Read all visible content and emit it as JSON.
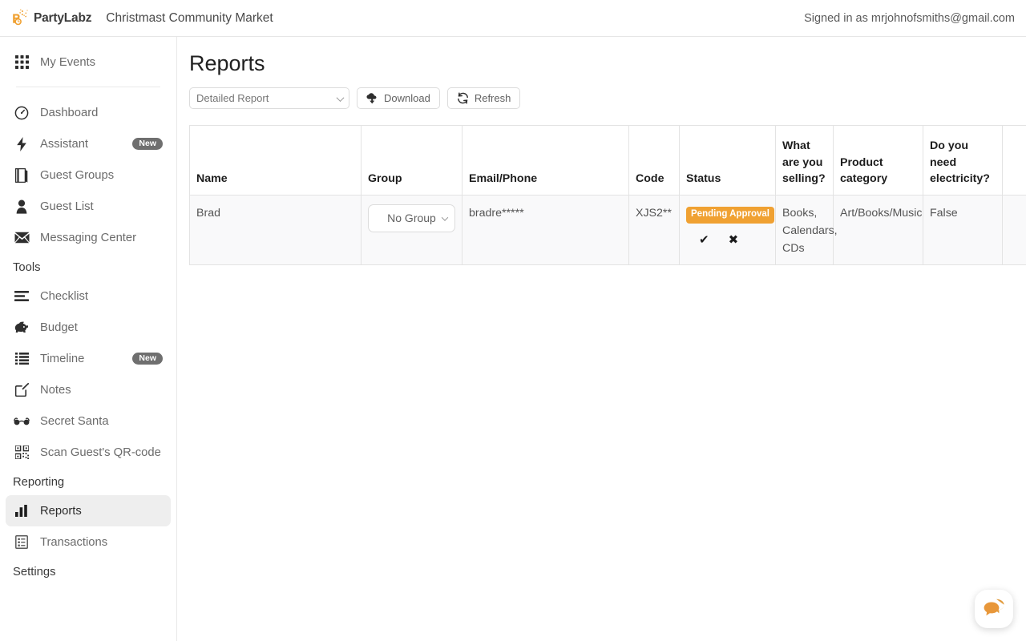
{
  "header": {
    "brand_name": "PartyLabz",
    "event_title": "Christmast Community Market",
    "signed_in": "Signed in as mrjohnofsmiths@gmail.com",
    "logo_icon": "partylabz-logo-icon"
  },
  "sidebar": {
    "top": [
      {
        "label": "My Events",
        "icon": "grid-icon"
      }
    ],
    "primary": [
      {
        "label": "Dashboard",
        "icon": "speedometer-icon",
        "badge": ""
      },
      {
        "label": "Assistant",
        "icon": "lightning-bolt-icon",
        "badge": "New"
      },
      {
        "label": "Guest Groups",
        "icon": "book-icon",
        "badge": ""
      },
      {
        "label": "Guest List",
        "icon": "person-icon",
        "badge": ""
      },
      {
        "label": "Messaging Center",
        "icon": "envelope-icon",
        "badge": ""
      }
    ],
    "tools_title": "Tools",
    "tools": [
      {
        "label": "Checklist",
        "icon": "checklist-icon",
        "badge": ""
      },
      {
        "label": "Budget",
        "icon": "piggy-bank-icon",
        "badge": ""
      },
      {
        "label": "Timeline",
        "icon": "list-icon",
        "badge": "New"
      },
      {
        "label": "Notes",
        "icon": "note-edit-icon",
        "badge": ""
      },
      {
        "label": "Secret Santa",
        "icon": "glasses-icon",
        "badge": ""
      },
      {
        "label": "Scan Guest's QR-code",
        "icon": "qr-code-icon",
        "badge": ""
      }
    ],
    "reporting_title": "Reporting",
    "reporting": [
      {
        "label": "Reports",
        "icon": "bar-chart-icon",
        "badge": "",
        "active": true
      },
      {
        "label": "Transactions",
        "icon": "receipt-icon",
        "badge": "",
        "active": false
      }
    ],
    "settings_title": "Settings"
  },
  "main": {
    "page_title": "Reports",
    "report_select": {
      "value": "Detailed Report",
      "options": [
        "Detailed Report"
      ]
    },
    "download_label": "Download",
    "refresh_label": "Refresh",
    "download_icon": "cloud-download-icon",
    "refresh_icon": "refresh-icon"
  },
  "table": {
    "columns": [
      "Name",
      "Group",
      "Email/Phone",
      "Code",
      "Status",
      "What are you selling?",
      "Product category",
      "Do you need electricity?",
      ""
    ],
    "rows": [
      {
        "name": "Brad",
        "group": "No Group",
        "email_phone": "bradre*****",
        "code": "XJS2**",
        "status_badge": "Pending Approval",
        "approve_icon": "check-icon",
        "reject_icon": "cross-icon",
        "selling": "Books, Calendars, CDs",
        "product_category": "Art/Books/Music",
        "electricity": "False",
        "extra": ""
      }
    ]
  },
  "chat": {
    "icon": "chat-bubbles-icon"
  },
  "colors": {
    "brand_orange": "#f0a132",
    "badge_gray": "#6f6f6f",
    "active_nav_bg": "#eeeeee",
    "row_bg": "#f9f9fa"
  }
}
